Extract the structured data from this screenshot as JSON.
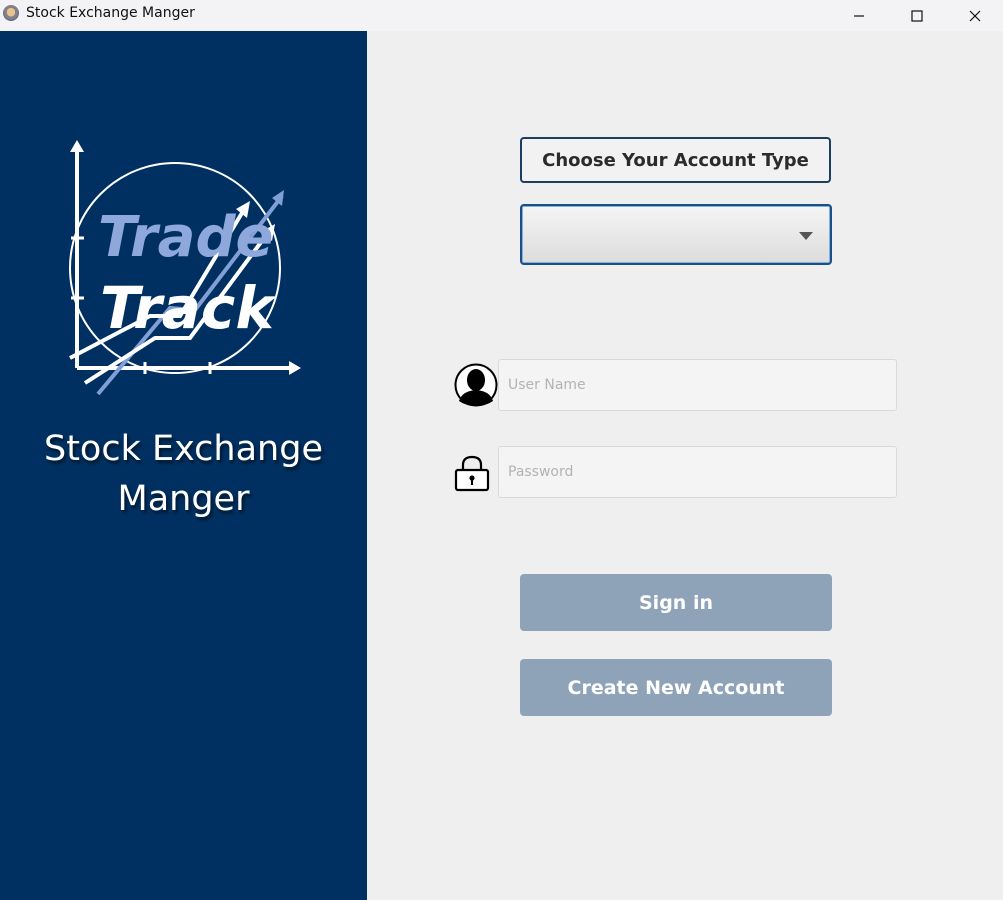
{
  "window": {
    "title": "Stock Exchange Manger"
  },
  "sidebar": {
    "logo_text_top": "Trade",
    "logo_text_bottom": "Track",
    "app_name_line1": "Stock Exchange",
    "app_name_line2": "Manger"
  },
  "form": {
    "account_type_label": "Choose Your  Account Type",
    "account_type_value": "",
    "username_placeholder": "User Name",
    "username_value": "",
    "password_placeholder": "Password",
    "password_value": "",
    "signin_label": "Sign in",
    "create_account_label": "Create New Account"
  },
  "icons": {
    "app": "app-icon",
    "minimize": "minimize-icon",
    "maximize": "maximize-icon",
    "close": "close-icon",
    "dropdown": "chevron-down-icon",
    "user": "user-icon",
    "lock": "lock-icon"
  },
  "colors": {
    "sidebar_bg": "#003061",
    "main_bg": "#efefef",
    "button_bg": "#8fa3b8",
    "label_border": "#1c3d66"
  }
}
